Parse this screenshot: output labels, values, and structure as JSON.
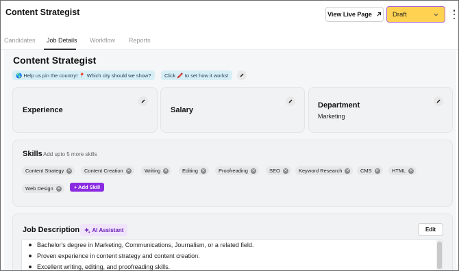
{
  "header": {
    "title": "Content Strategist",
    "view_live_label": "View Live Page",
    "status_value": "Draft"
  },
  "tabs": [
    {
      "label": "Candidates",
      "active": false
    },
    {
      "label": "Job Details",
      "active": true
    },
    {
      "label": "Workflow",
      "active": false
    },
    {
      "label": "Reports",
      "active": false
    }
  ],
  "job": {
    "title": "Content Strategist",
    "hint_location": "🌎 Help us pin the country! 📍 Which city should we show?",
    "hint_click": "Click 🖍️ to set how it works!"
  },
  "cards": {
    "experience": {
      "title": "Experience"
    },
    "salary": {
      "title": "Salary"
    },
    "department": {
      "title": "Department",
      "value": "Marketing"
    }
  },
  "skills": {
    "label": "Skills",
    "hint": "Add upto 5 more skills",
    "items": [
      "Content Strategy",
      "Content Creation",
      "Writing",
      "Editing",
      "Proofreading",
      "SEO",
      "Keyword Research",
      "CMS",
      "HTML",
      "Web Design"
    ],
    "add_label": "+ Add Skill"
  },
  "job_description": {
    "title": "Job Description",
    "ai_label": "AI Assistant",
    "edit_label": "Edit",
    "bullets": [
      "Bachelor's degree in Marketing, Communications, Journalism, or a related field.",
      "Proven experience in content strategy and content creation.",
      "Excellent writing, editing, and proofreading skills."
    ]
  },
  "colors": {
    "draft_bg": "#ffd252",
    "draft_border": "#b061d6",
    "accent_purple": "#8a2be2",
    "hint_bg": "#d7eef7"
  }
}
